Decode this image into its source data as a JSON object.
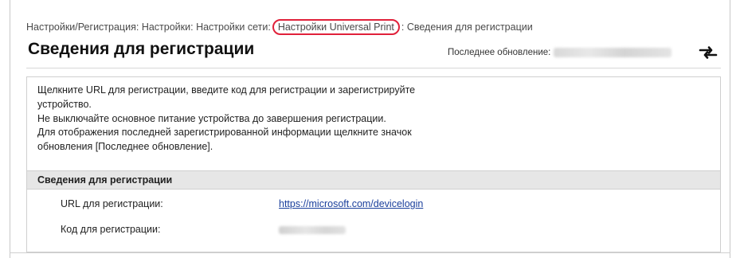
{
  "breadcrumb": {
    "items": [
      "Настройки/Регистрация",
      "Настройки",
      "Настройки сети",
      "Настройки Universal Print"
    ],
    "separator": ":",
    "current": "Сведения для регистрации",
    "highlight_color": "#e0213a"
  },
  "page": {
    "title": "Сведения для регистрации",
    "last_update_label": "Последнее обновление:",
    "refresh_icon": "refresh-icon"
  },
  "instructions": {
    "lines": [
      "Щелкните URL для регистрации, введите код для регистрации и зарегистрируйте",
      "устройство.",
      "Не выключайте основное питание устройства до завершения регистрации.",
      "Для отображения последней зарегистрированной информации щелкните значок",
      "обновления [Последнее обновление]."
    ]
  },
  "registration": {
    "section_title": "Сведения для регистрации",
    "url_label": "URL для регистрации:",
    "url_value": "https://microsoft.com/devicelogin",
    "code_label": "Код для регистрации:"
  },
  "colors": {
    "link": "#1a3f9c",
    "section_header_bg": "#e6e6e6"
  }
}
